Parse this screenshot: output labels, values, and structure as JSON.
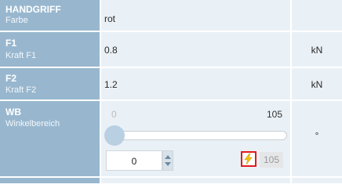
{
  "rows": [
    {
      "name": "HANDGRIFF",
      "desc": "Farbe",
      "value": "rot",
      "unit": ""
    },
    {
      "name": "F1",
      "desc": "Kraft F1",
      "value": "0.8",
      "unit": "kN"
    },
    {
      "name": "F2",
      "desc": "Kraft F2",
      "value": "1.2",
      "unit": "kN"
    }
  ],
  "wb": {
    "name": "WB",
    "desc": "Winkelbereich",
    "min": "0",
    "max": "105",
    "value": "0",
    "max_badge": "105",
    "unit": "°",
    "slider_fraction": 0
  },
  "icons": {
    "bolt": "lightning-icon"
  },
  "colors": {
    "label_bg": "#98b7cf",
    "value_bg": "#eaf1f6",
    "highlight": "#e31b1b",
    "bolt": "#f1c40f"
  }
}
